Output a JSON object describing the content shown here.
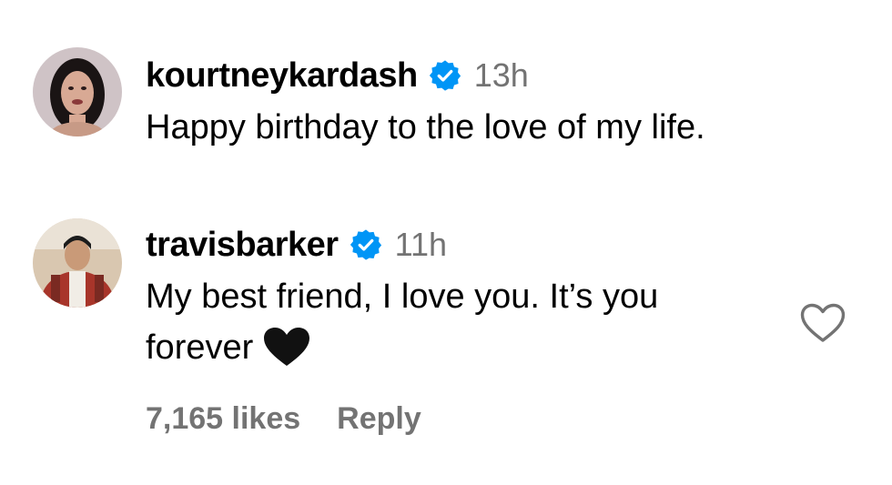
{
  "comments": [
    {
      "username": "kourtneykardash",
      "verified": true,
      "timestamp": "13h",
      "text": "Happy birthday to the love of my life."
    },
    {
      "username": "travisbarker",
      "verified": true,
      "timestamp": "11h",
      "text_line1": "My best friend, I love you. It’s you",
      "text_line2": "forever",
      "emoji": "black-heart",
      "likes": "7,165 likes",
      "reply_label": "Reply"
    }
  ],
  "colors": {
    "verified_blue": "#0095f6",
    "secondary_text": "#737373",
    "text": "#000000"
  },
  "icons": {
    "verified": "verified-badge-icon",
    "like": "heart-outline-icon"
  }
}
